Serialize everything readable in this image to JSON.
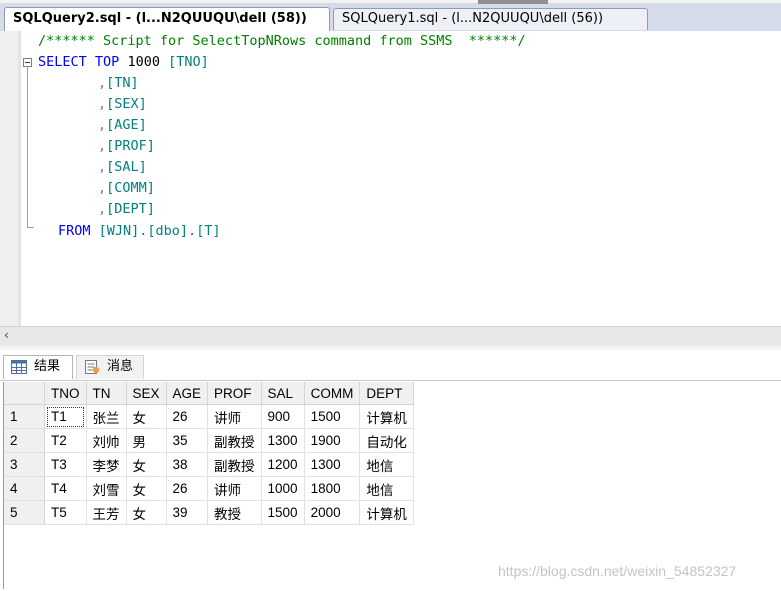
{
  "tabs": [
    {
      "label": "SQLQuery2.sql - (l...N2QUUQU\\dell (58))",
      "active": true
    },
    {
      "label": "SQLQuery1.sql - (l...N2QUUQU\\dell (56))",
      "active": false
    }
  ],
  "editor": {
    "comment": "/****** Script for SelectTopNRows command from SSMS  ******/",
    "kw_select": "SELECT",
    "kw_top": "TOP",
    "top_n": "1000",
    "col_first": "[TNO]",
    "columns": [
      ",[TN]",
      ",[SEX]",
      ",[AGE]",
      ",[PROF]",
      ",[SAL]",
      ",[COMM]",
      ",[DEPT]"
    ],
    "kw_from": "FROM",
    "table": "[WJN].[dbo].[T]"
  },
  "result_tabs": {
    "results_label": "结果",
    "messages_label": "消息"
  },
  "grid": {
    "headers": [
      "TNO",
      "TN",
      "SEX",
      "AGE",
      "PROF",
      "SAL",
      "COMM",
      "DEPT"
    ],
    "rows": [
      [
        "1",
        "T1",
        "张兰",
        "女",
        "26",
        "讲师",
        "900",
        "1500",
        "计算机"
      ],
      [
        "2",
        "T2",
        "刘帅",
        "男",
        "35",
        "副教授",
        "1300",
        "1900",
        "自动化"
      ],
      [
        "3",
        "T3",
        "李梦",
        "女",
        "38",
        "副教授",
        "1200",
        "1300",
        "地信"
      ],
      [
        "4",
        "T4",
        "刘雪",
        "女",
        "26",
        "讲师",
        "1000",
        "1800",
        "地信"
      ],
      [
        "5",
        "T5",
        "王芳",
        "女",
        "39",
        "教授",
        "1500",
        "2000",
        "计算机"
      ]
    ]
  },
  "watermark": "https://blog.csdn.net/weixin_54852327",
  "icons": {
    "scroll_left": "‹"
  }
}
